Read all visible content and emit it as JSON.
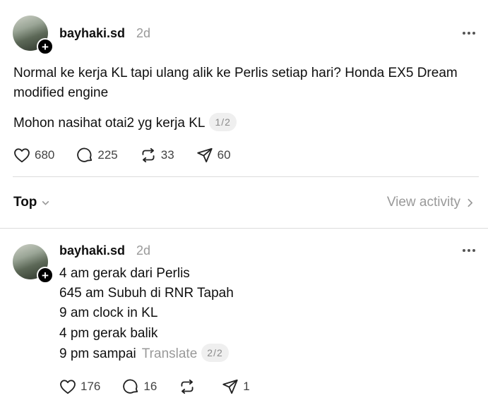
{
  "post": {
    "username": "bayhaki.sd",
    "time": "2d",
    "text_line1": "Normal ke kerja KL tapi ulang alik ke Perlis setiap hari? Honda EX5 Dream",
    "text_line2": "modified engine",
    "text_line3": "Mohon nasihat otai2 yg kerja KL",
    "page_indicator": "1/2",
    "likes": "680",
    "comments": "225",
    "reposts": "33",
    "shares": "60"
  },
  "sort": {
    "label": "Top",
    "view_activity": "View activity"
  },
  "reply": {
    "username": "bayhaki.sd",
    "time": "2d",
    "lines": [
      "4 am gerak dari Perlis",
      "645 am Subuh di RNR Tapah",
      "9 am clock in KL",
      "4 pm gerak balik",
      "9 pm sampai"
    ],
    "translate": "Translate",
    "page_indicator": "2/2",
    "likes": "176",
    "comments": "16",
    "reposts": "",
    "shares": "1"
  },
  "icons": [
    "plus-icon",
    "more-icon",
    "heart-icon",
    "comment-icon",
    "repost-icon",
    "share-icon",
    "chevron-down-icon",
    "chevron-right-icon"
  ],
  "colors": {
    "text": "#101010",
    "muted": "#999999",
    "divider": "#dcdcdc"
  }
}
